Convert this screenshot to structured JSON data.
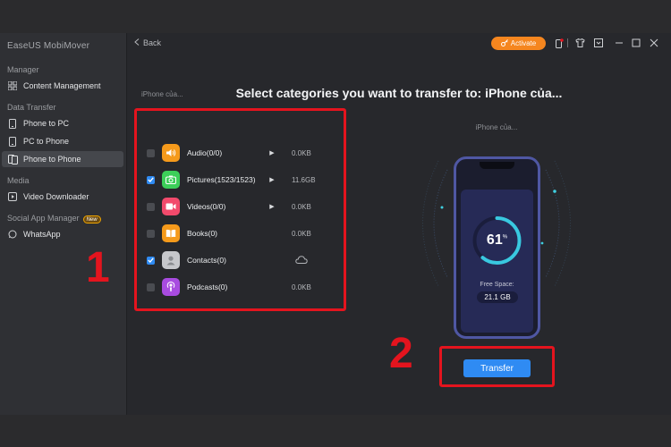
{
  "app": {
    "title": "EaseUS MobiMover"
  },
  "sidebar": {
    "sections": [
      {
        "label": "Manager",
        "items": [
          {
            "label": "Content Management",
            "icon": "grid-icon"
          }
        ]
      },
      {
        "label": "Data Transfer",
        "items": [
          {
            "label": "Phone to PC",
            "icon": "phone-icon"
          },
          {
            "label": "PC to Phone",
            "icon": "phone-icon"
          },
          {
            "label": "Phone to Phone",
            "icon": "phones-icon",
            "active": true
          }
        ]
      },
      {
        "label": "Media",
        "items": [
          {
            "label": "Video Downloader",
            "icon": "play-icon"
          }
        ]
      },
      {
        "label": "Social App Manager",
        "badge": "New",
        "items": [
          {
            "label": "WhatsApp",
            "icon": "whatsapp-icon"
          }
        ]
      }
    ]
  },
  "topbar": {
    "back_label": "Back",
    "activate_label": "Activate"
  },
  "main": {
    "heading": "Select categories you want to transfer to: iPhone của...",
    "source_device": "iPhone của...",
    "target_device": "iPhone của...",
    "categories": [
      {
        "label": "Audio(0/0)",
        "size": "0.0KB",
        "checked": false,
        "arrow": true,
        "icon": "speaker-icon",
        "color": "#f59a1b"
      },
      {
        "label": "Pictures(1523/1523)",
        "size": "11.6GB",
        "checked": true,
        "arrow": true,
        "icon": "camera-icon",
        "color": "#3ccf59"
      },
      {
        "label": "Videos(0/0)",
        "size": "0.0KB",
        "checked": false,
        "arrow": true,
        "icon": "video-icon",
        "color": "#f24a6c"
      },
      {
        "label": "Books(0)",
        "size": "0.0KB",
        "checked": false,
        "arrow": false,
        "icon": "book-icon",
        "color": "#f59a1b"
      },
      {
        "label": "Contacts(0)",
        "size": "",
        "checked": true,
        "arrow": false,
        "icon": "contact-icon",
        "color": "#c6c7cb",
        "cloud": true
      },
      {
        "label": "Podcasts(0)",
        "size": "0.0KB",
        "checked": false,
        "arrow": false,
        "icon": "podcast-icon",
        "color": "#a84be0"
      }
    ],
    "storage": {
      "value": "61",
      "unit": "%",
      "free_label": "Free Space:",
      "free_value": "21.1 GB",
      "fraction": 0.61
    },
    "transfer_label": "Transfer"
  },
  "annotations": {
    "step1": "1",
    "step2": "2"
  },
  "colors": {
    "accent": "#2f8bf3",
    "highlight": "#e4141e",
    "activate": "#f5861f"
  }
}
